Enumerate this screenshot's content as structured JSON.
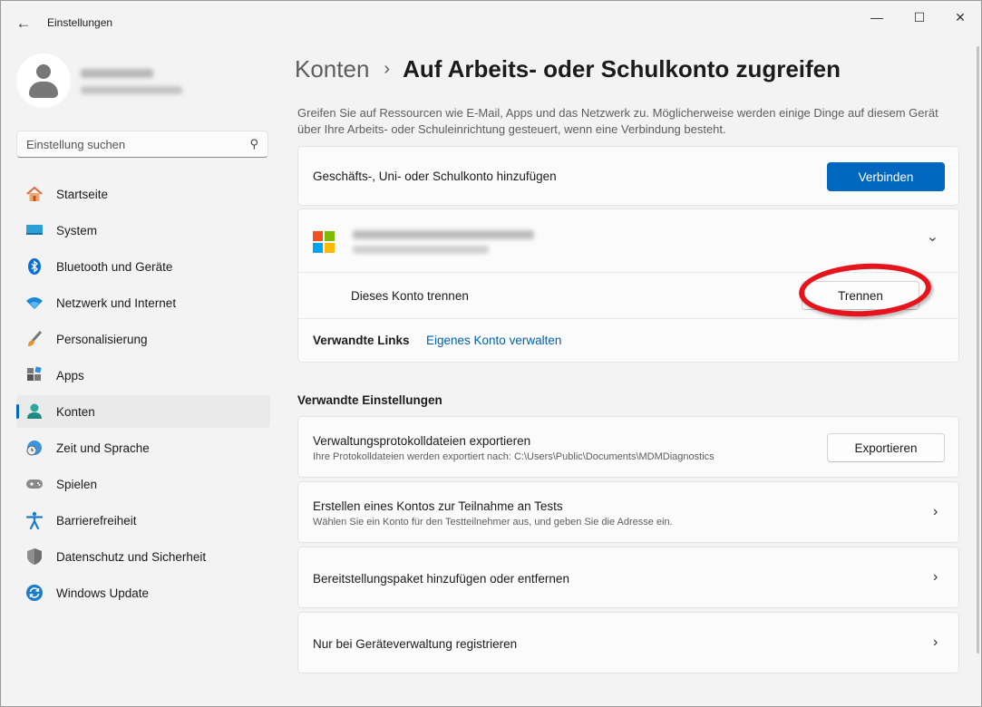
{
  "window": {
    "title": "Einstellungen",
    "controls": {
      "minimize": "—",
      "maximize": "☐",
      "close": "✕"
    }
  },
  "search": {
    "placeholder": "Einstellung suchen"
  },
  "nav": [
    {
      "label": "Startseite",
      "icon": "home-icon"
    },
    {
      "label": "System",
      "icon": "system-icon"
    },
    {
      "label": "Bluetooth und Geräte",
      "icon": "bluetooth-icon"
    },
    {
      "label": "Netzwerk und Internet",
      "icon": "wifi-icon"
    },
    {
      "label": "Personalisierung",
      "icon": "brush-icon"
    },
    {
      "label": "Apps",
      "icon": "apps-icon"
    },
    {
      "label": "Konten",
      "icon": "account-icon",
      "active": true
    },
    {
      "label": "Zeit und Sprache",
      "icon": "clock-globe-icon"
    },
    {
      "label": "Spielen",
      "icon": "gamepad-icon"
    },
    {
      "label": "Barrierefreiheit",
      "icon": "accessibility-icon"
    },
    {
      "label": "Datenschutz und Sicherheit",
      "icon": "shield-icon"
    },
    {
      "label": "Windows Update",
      "icon": "update-icon"
    }
  ],
  "breadcrumb": {
    "parent": "Konten",
    "separator": "›",
    "current": "Auf Arbeits- oder Schulkonto zugreifen"
  },
  "description": "Greifen Sie auf Ressourcen wie E-Mail, Apps und das Netzwerk zu. Möglicherweise werden einige Dinge auf diesem Gerät über Ihre Arbeits- oder Schuleinrichtung gesteuert, wenn eine Verbindung besteht.",
  "add_account": {
    "label": "Geschäfts-, Uni- oder Schulkonto hinzufügen",
    "button": "Verbinden"
  },
  "account": {
    "disconnect_label": "Dieses Konto trennen",
    "disconnect_button": "Trennen",
    "related_links_label": "Verwandte Links",
    "manage_link": "Eigenes Konto verwalten"
  },
  "related_settings": {
    "heading": "Verwandte Einstellungen",
    "export": {
      "title": "Verwaltungsprotokolldateien exportieren",
      "subtitle": "Ihre Protokolldateien werden exportiert nach: C:\\Users\\Public\\Documents\\MDMDiagnostics",
      "button": "Exportieren"
    },
    "test_account": {
      "title": "Erstellen eines Kontos zur Teilnahme an Tests",
      "subtitle": "Wählen Sie ein Konto für den Testteilnehmer aus, und geben Sie die Adresse ein."
    },
    "provisioning": {
      "title": "Bereitstellungspaket hinzufügen oder entfernen"
    },
    "enroll": {
      "title": "Nur bei Geräteverwaltung registrieren"
    }
  },
  "colors": {
    "accent": "#0067c0",
    "annotation": "#e6141c"
  }
}
